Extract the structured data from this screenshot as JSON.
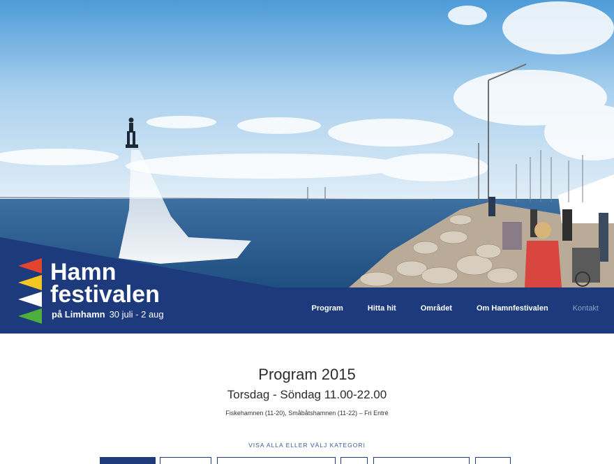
{
  "brand": {
    "line1": "Hamn",
    "line2": "festivalen",
    "place": "på Limhamn",
    "dates": "30 juli - 2 aug",
    "flag_colors": [
      "#e4432f",
      "#f4c623",
      "#ffffff",
      "#4caf3e"
    ],
    "primary_color": "#1c3a7c"
  },
  "nav": {
    "items": [
      {
        "label": "Program"
      },
      {
        "label": "Hitta hit"
      },
      {
        "label": "Området"
      },
      {
        "label": "Om Hamnfestivalen"
      },
      {
        "label": "Kontakt"
      }
    ]
  },
  "content": {
    "title": "Program 2015",
    "subtitle": "Torsdag - Söndag 11.00-22.00",
    "info": "Fiskehamnen (11-20), Småbåtshamnen (11-22) – Fri Entré",
    "filter_label": "VISA ALLA ELLER VÄLJ KATEGORI"
  }
}
